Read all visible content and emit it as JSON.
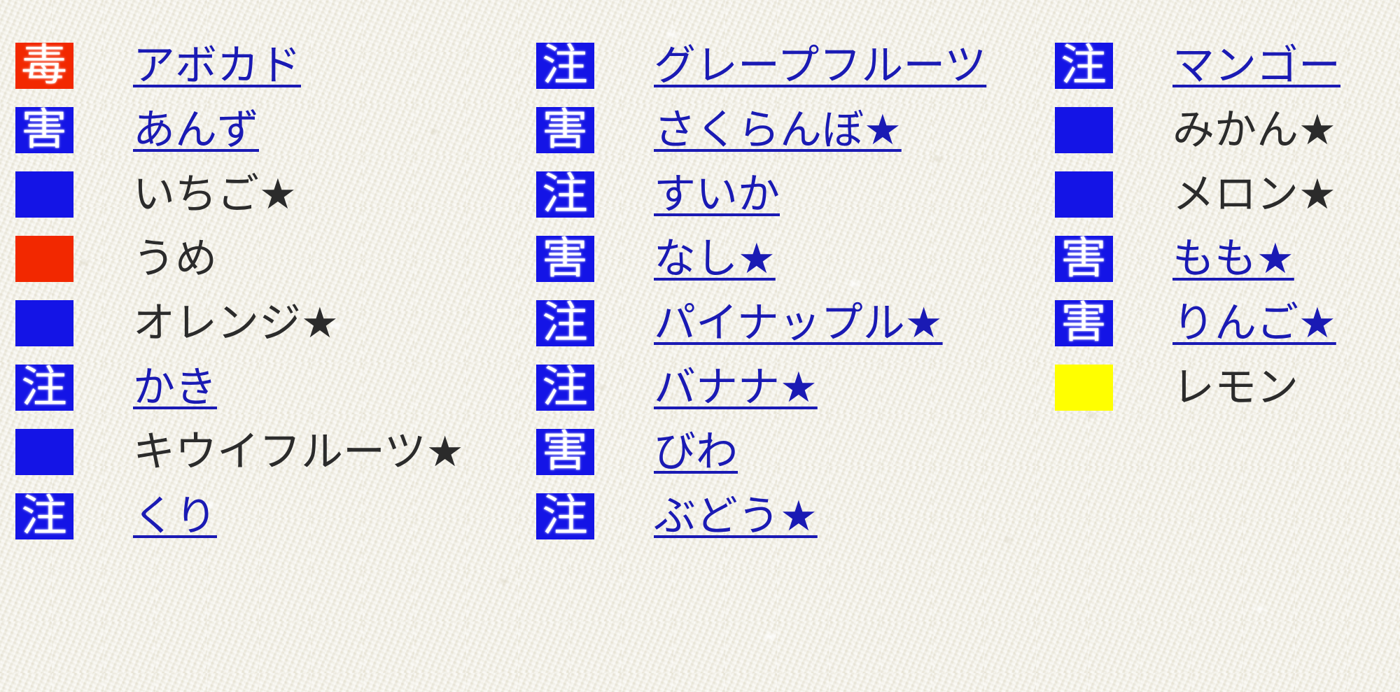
{
  "page": {
    "background_color": "#f2f0e5",
    "link_color": "#1a1ab4",
    "text_color": "#2b2b2b"
  },
  "legend": {
    "marker_colors": {
      "poison": "#f22800",
      "harm": "#1414e6",
      "caution": "#1414e6",
      "blue_blank": "#1414e6",
      "red_blank": "#f22800",
      "yellow_blank": "#ffff00"
    },
    "marker_glyphs": {
      "poison": "毒",
      "harm": "害",
      "caution": "注",
      "blank": ""
    }
  },
  "columns": [
    {
      "items": [
        {
          "marker_glyph": "毒",
          "marker_color": "#f22800",
          "marker_name": "poison-marker",
          "label": "アボカド",
          "is_link": true
        },
        {
          "marker_glyph": "害",
          "marker_color": "#1414e6",
          "marker_name": "harm-marker",
          "label": "あんず",
          "is_link": true
        },
        {
          "marker_glyph": "",
          "marker_color": "#1414e6",
          "marker_name": "blue-marker",
          "label": "いちご★",
          "is_link": false
        },
        {
          "marker_glyph": "",
          "marker_color": "#f22800",
          "marker_name": "red-marker",
          "label": "うめ",
          "is_link": false
        },
        {
          "marker_glyph": "",
          "marker_color": "#1414e6",
          "marker_name": "blue-marker",
          "label": "オレンジ★",
          "is_link": false
        },
        {
          "marker_glyph": "注",
          "marker_color": "#1414e6",
          "marker_name": "caution-marker",
          "label": "かき",
          "is_link": true
        },
        {
          "marker_glyph": "",
          "marker_color": "#1414e6",
          "marker_name": "blue-marker",
          "label": "キウイフルーツ★",
          "is_link": false
        },
        {
          "marker_glyph": "注",
          "marker_color": "#1414e6",
          "marker_name": "caution-marker",
          "label": "くり",
          "is_link": true
        }
      ]
    },
    {
      "items": [
        {
          "marker_glyph": "注",
          "marker_color": "#1414e6",
          "marker_name": "caution-marker",
          "label": "グレープフルーツ",
          "is_link": true
        },
        {
          "marker_glyph": "害",
          "marker_color": "#1414e6",
          "marker_name": "harm-marker",
          "label": "さくらんぼ★",
          "is_link": true
        },
        {
          "marker_glyph": "注",
          "marker_color": "#1414e6",
          "marker_name": "caution-marker",
          "label": "すいか",
          "is_link": true
        },
        {
          "marker_glyph": "害",
          "marker_color": "#1414e6",
          "marker_name": "harm-marker",
          "label": "なし★",
          "is_link": true
        },
        {
          "marker_glyph": "注",
          "marker_color": "#1414e6",
          "marker_name": "caution-marker",
          "label": "パイナップル★",
          "is_link": true
        },
        {
          "marker_glyph": "注",
          "marker_color": "#1414e6",
          "marker_name": "caution-marker",
          "label": "バナナ★",
          "is_link": true
        },
        {
          "marker_glyph": "害",
          "marker_color": "#1414e6",
          "marker_name": "harm-marker",
          "label": "びわ",
          "is_link": true
        },
        {
          "marker_glyph": "注",
          "marker_color": "#1414e6",
          "marker_name": "caution-marker",
          "label": "ぶどう★",
          "is_link": true
        }
      ]
    },
    {
      "items": [
        {
          "marker_glyph": "注",
          "marker_color": "#1414e6",
          "marker_name": "caution-marker",
          "label": "マンゴー",
          "is_link": true
        },
        {
          "marker_glyph": "",
          "marker_color": "#1414e6",
          "marker_name": "blue-marker",
          "label": "みかん★",
          "is_link": false
        },
        {
          "marker_glyph": "",
          "marker_color": "#1414e6",
          "marker_name": "blue-marker",
          "label": "メロン★",
          "is_link": false
        },
        {
          "marker_glyph": "害",
          "marker_color": "#1414e6",
          "marker_name": "harm-marker",
          "label": "もも★",
          "is_link": true
        },
        {
          "marker_glyph": "害",
          "marker_color": "#1414e6",
          "marker_name": "harm-marker",
          "label": "りんご★",
          "is_link": true
        },
        {
          "marker_glyph": "",
          "marker_color": "#ffff00",
          "marker_name": "yellow-marker",
          "label": "レモン",
          "is_link": false
        }
      ]
    }
  ]
}
